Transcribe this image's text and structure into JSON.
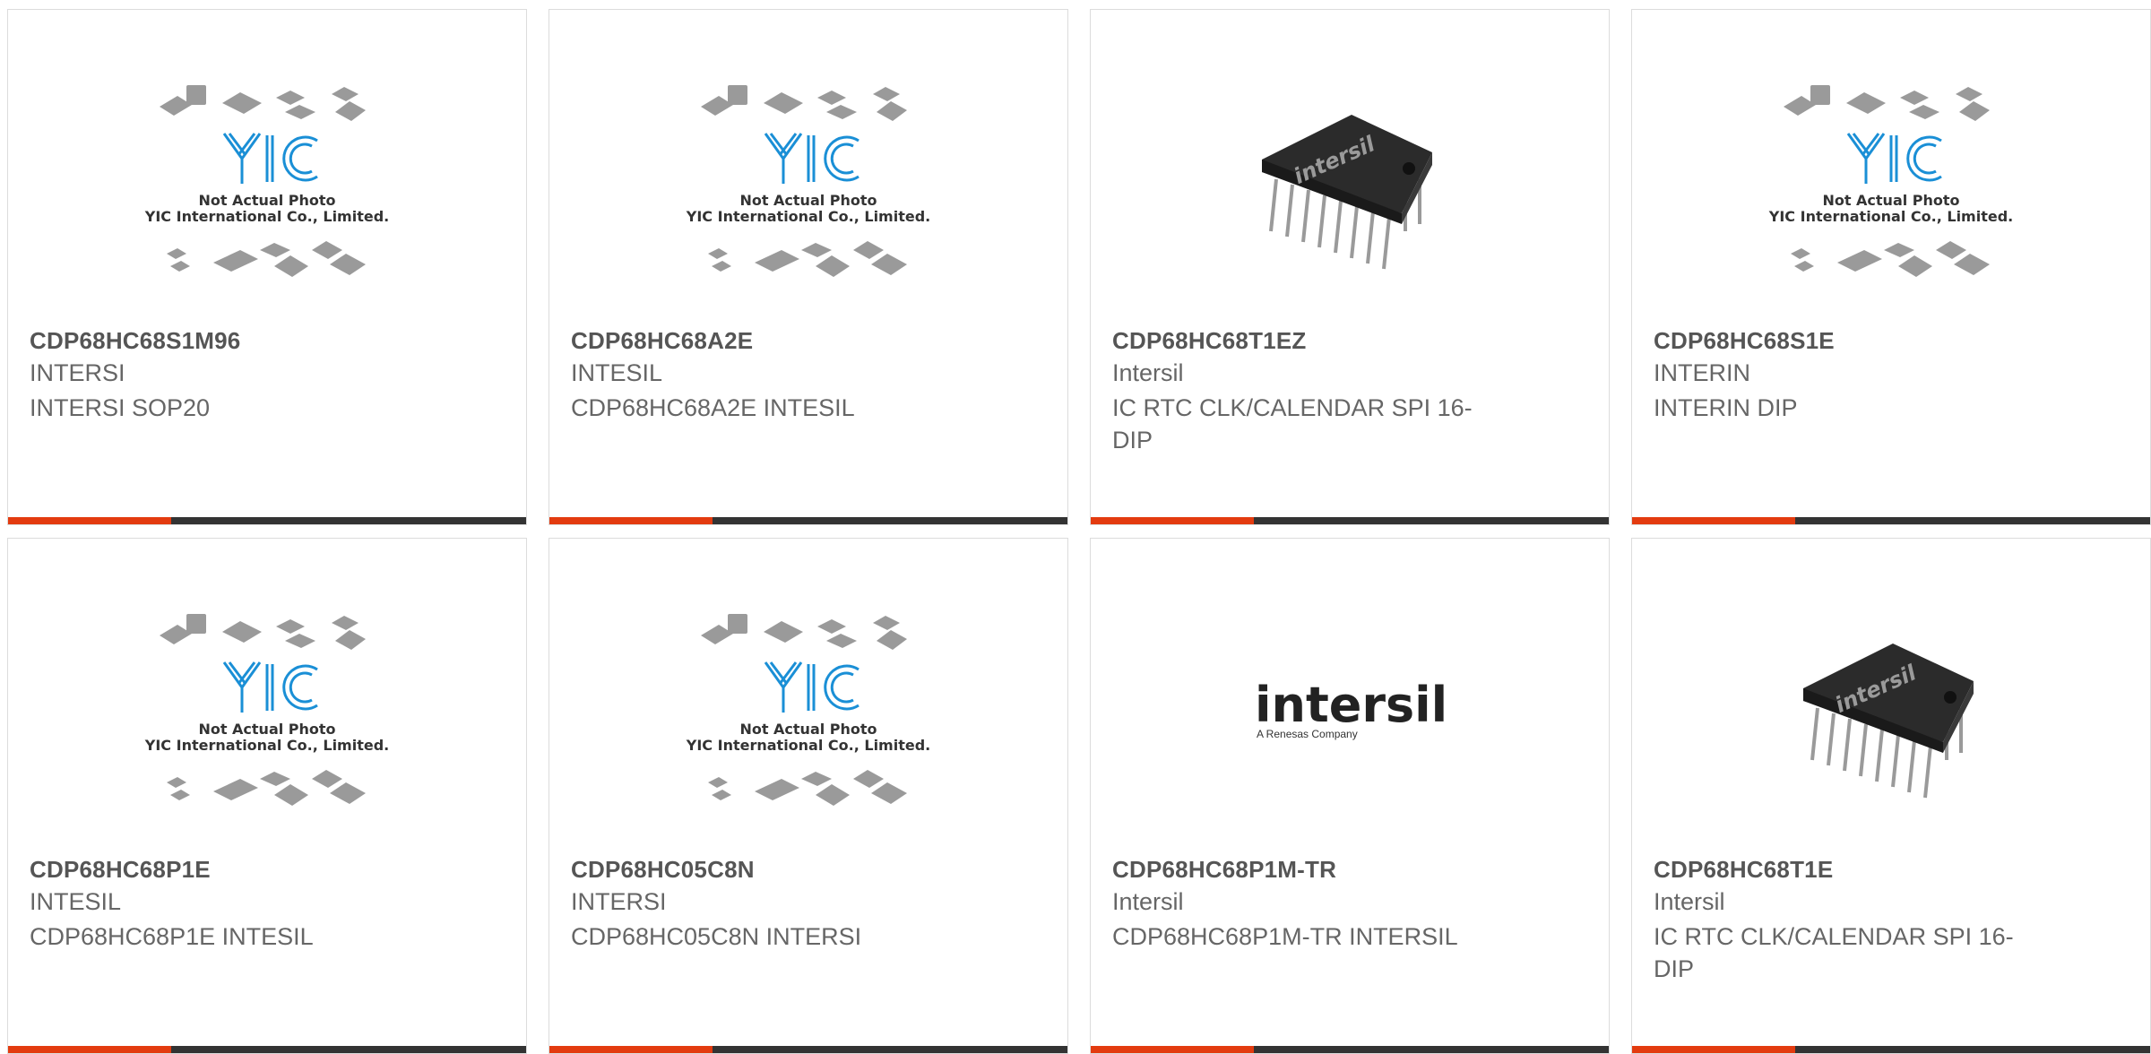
{
  "colors": {
    "accent": "#e33b0f",
    "bar": "#333333",
    "border": "#dcdcdc",
    "logo_blue": "#1a8fd6"
  },
  "placeholder": {
    "line1": "Not Actual Photo",
    "line2": "YIC International Co., Limited.",
    "logo_text": "YIC"
  },
  "intersil_logo": {
    "wordmark": "intersil",
    "tagline": "A Renesas Company"
  },
  "products": [
    {
      "part": "CDP68HC68S1M96",
      "maker": "INTERSI",
      "desc": "INTERSI SOP20",
      "image": "placeholder"
    },
    {
      "part": "CDP68HC68A2E",
      "maker": "INTESIL",
      "desc": "CDP68HC68A2E INTESIL",
      "image": "placeholder"
    },
    {
      "part": "CDP68HC68T1EZ",
      "maker": "Intersil",
      "desc": "IC RTC CLK/CALENDAR SPI 16-DIP",
      "image": "dip-chip",
      "chip_label": "intersil"
    },
    {
      "part": "CDP68HC68S1E",
      "maker": "INTERIN",
      "desc": "INTERIN DIP",
      "image": "placeholder"
    },
    {
      "part": "CDP68HC68P1E",
      "maker": "INTESIL",
      "desc": "CDP68HC68P1E INTESIL",
      "image": "placeholder"
    },
    {
      "part": "CDP68HC05C8N",
      "maker": "INTERSI",
      "desc": "CDP68HC05C8N INTERSI",
      "image": "placeholder"
    },
    {
      "part": "CDP68HC68P1M-TR",
      "maker": "Intersil",
      "desc": "CDP68HC68P1M-TR INTERSIL",
      "image": "intersil-logo"
    },
    {
      "part": "CDP68HC68T1E",
      "maker": "Intersil",
      "desc": "IC RTC CLK/CALENDAR SPI 16-DIP",
      "image": "dip-chip",
      "chip_label": "intersil"
    }
  ]
}
